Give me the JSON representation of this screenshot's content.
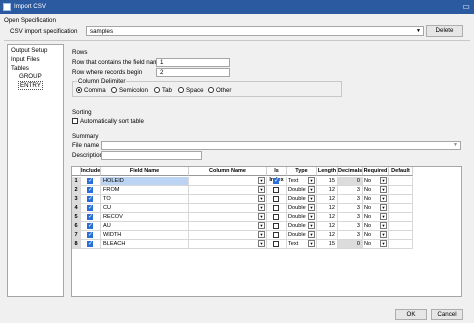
{
  "window": {
    "title": "Import CSV"
  },
  "open_spec": {
    "heading": "Open Specification",
    "label": "CSV import specification",
    "value": "samples",
    "delete_label": "Delete"
  },
  "nav": {
    "items": [
      "Output Setup",
      "Input Files",
      "Tables",
      "GROUP",
      "ENTRY"
    ]
  },
  "rows": {
    "heading": "Rows",
    "field_names_label": "Row that contains the field names",
    "field_names_value": "1",
    "records_label": "Row where records begin",
    "records_value": "2",
    "delimiter_heading": "Column Delimiter",
    "delimiters": [
      "Comma",
      "Semicolon",
      "Tab",
      "Space",
      "Other"
    ]
  },
  "sorting": {
    "heading": "Sorting",
    "auto_sort_label": "Automatically sort table"
  },
  "summary": {
    "heading": "Summary",
    "file_name_label": "File name",
    "description_label": "Description"
  },
  "grid": {
    "headers": [
      "",
      "Include",
      "Field Name",
      "Column Name",
      "Is Index",
      "Type",
      "Length",
      "Decimals",
      "Required",
      "Default"
    ],
    "rows": [
      {
        "n": "1",
        "include": true,
        "field": "HOLEID",
        "index": true,
        "type": "Text",
        "length": "15",
        "decimals": "0",
        "required": "No"
      },
      {
        "n": "2",
        "include": true,
        "field": "FROM",
        "index": false,
        "type": "Double",
        "length": "12",
        "decimals": "3",
        "required": "No"
      },
      {
        "n": "3",
        "include": true,
        "field": "TO",
        "index": false,
        "type": "Double",
        "length": "12",
        "decimals": "3",
        "required": "No"
      },
      {
        "n": "4",
        "include": true,
        "field": "CU",
        "index": false,
        "type": "Double",
        "length": "12",
        "decimals": "3",
        "required": "No"
      },
      {
        "n": "5",
        "include": true,
        "field": "RECOV",
        "index": false,
        "type": "Double",
        "length": "12",
        "decimals": "3",
        "required": "No"
      },
      {
        "n": "6",
        "include": true,
        "field": "AU",
        "index": false,
        "type": "Double",
        "length": "12",
        "decimals": "3",
        "required": "No"
      },
      {
        "n": "7",
        "include": true,
        "field": "WIDTH",
        "index": false,
        "type": "Double",
        "length": "12",
        "decimals": "3",
        "required": "No"
      },
      {
        "n": "8",
        "include": true,
        "field": "BLEACH",
        "index": false,
        "type": "Text",
        "length": "15",
        "decimals": "0",
        "required": "No"
      }
    ]
  },
  "footer": {
    "ok_label": "OK",
    "cancel_label": "Cancel"
  },
  "colors": {
    "titlebar": "#2c5aa0",
    "checked": "#2b6fd6",
    "selected_row": "#bcd4f4"
  }
}
